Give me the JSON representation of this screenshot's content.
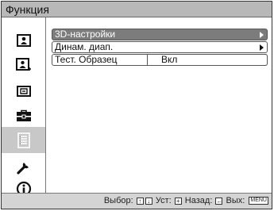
{
  "header": {
    "title": "Функция"
  },
  "sidebar": {
    "items": [
      {
        "icon": "picture-icon"
      },
      {
        "icon": "advanced-picture-icon"
      },
      {
        "icon": "screen-icon"
      },
      {
        "icon": "setup-icon"
      },
      {
        "icon": "function-icon",
        "active": true
      },
      {
        "icon": "installation-icon"
      },
      {
        "icon": "information-icon"
      }
    ]
  },
  "menu": {
    "items": [
      {
        "label": "3D-настройки"
      },
      {
        "label": "Динам. диап."
      },
      {
        "label": "Тест. Образец",
        "value": "Вкл"
      }
    ]
  },
  "footer": {
    "select_label": "Выбор:",
    "set_label": "Уст:",
    "back_label": "Назад:",
    "exit_label": "Вых:",
    "menu_key": "MENU"
  },
  "colors": {
    "highlight": "#7c7c7c",
    "title_bg": "#b8b8b8",
    "active_side": "#c8c8c8"
  }
}
